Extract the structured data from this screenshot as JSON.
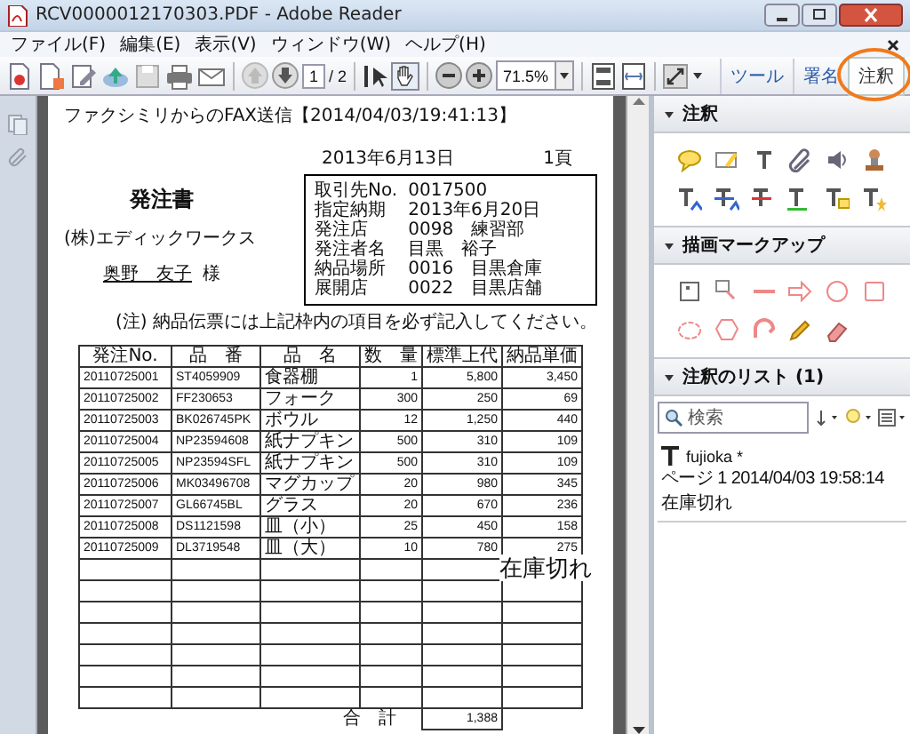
{
  "window": {
    "title": "RCV0000012170303.PDF - Adobe Reader"
  },
  "menu": [
    "ファイル(F)",
    "編集(E)",
    "表示(V)",
    "ウィンドウ(W)",
    "ヘルプ(H)"
  ],
  "toolbar": {
    "page": "1",
    "page_total": "/ 2",
    "zoom": "71.5%"
  },
  "tabs": [
    {
      "label": "ツール",
      "selected": false
    },
    {
      "label": "署名",
      "selected": false
    },
    {
      "label": "注釈",
      "selected": true
    }
  ],
  "document": {
    "fax_header": "ファクシミリからのFAX送信【2014/04/03/19:41:13】",
    "date": "2013年6月13日",
    "page_no": "1頁",
    "title": "発注書",
    "company": "(株)エディックワークス",
    "recipient": "奥野　友子",
    "honorific": "様",
    "info": [
      {
        "label": "取引先No.",
        "value": "0017500"
      },
      {
        "label": "指定納期",
        "value": "2013年6月20日"
      },
      {
        "label": "発注店",
        "value": "0098　練習部"
      },
      {
        "label": "発注者名",
        "value": "目黒　裕子"
      },
      {
        "label": "納品場所",
        "value": "0016　目黒倉庫"
      },
      {
        "label": "展開店",
        "value": "0022　目黒店舗"
      }
    ],
    "note": "(注) 納品伝票には上記枠内の項目を必ず記入してください。",
    "table": {
      "columns": [
        "発注No.",
        "品　番",
        "品　名",
        "数　量",
        "標準上代",
        "納品単価"
      ],
      "rows": [
        [
          "20110725001",
          "ST4059909",
          "食器棚",
          "1",
          "5,800",
          "3,450"
        ],
        [
          "20110725002",
          "FF230653",
          "フォーク",
          "300",
          "250",
          "69"
        ],
        [
          "20110725003",
          "BK026745PK",
          "ボウル",
          "12",
          "1,250",
          "440"
        ],
        [
          "20110725004",
          "NP23594608",
          "紙ナプキン",
          "500",
          "310",
          "109"
        ],
        [
          "20110725005",
          "NP23594SFL",
          "紙ナプキン",
          "500",
          "310",
          "109"
        ],
        [
          "20110725006",
          "MK03496708",
          "マグカップ",
          "20",
          "980",
          "345"
        ],
        [
          "20110725007",
          "GL66745BL",
          "グラス",
          "20",
          "670",
          "236"
        ],
        [
          "20110725008",
          "DS1121598",
          "皿（小）",
          "25",
          "450",
          "158"
        ],
        [
          "20110725009",
          "DL3719548",
          "皿（大）",
          "10",
          "780",
          "275"
        ]
      ]
    },
    "total_label": "合　計",
    "total": "1,388",
    "sticky_text": "在庫切れ"
  },
  "panel": {
    "sections": [
      {
        "title": "注釈",
        "expanded": true
      },
      {
        "title": "描画マークアップ",
        "expanded": true
      }
    ],
    "list": {
      "title": "注釈のリスト (1)",
      "expanded": true,
      "search_placeholder": "検索",
      "comments": [
        {
          "author": "fujioka *",
          "meta": "ページ 1 2014/04/03 19:58:14",
          "text": "在庫切れ"
        }
      ]
    }
  }
}
